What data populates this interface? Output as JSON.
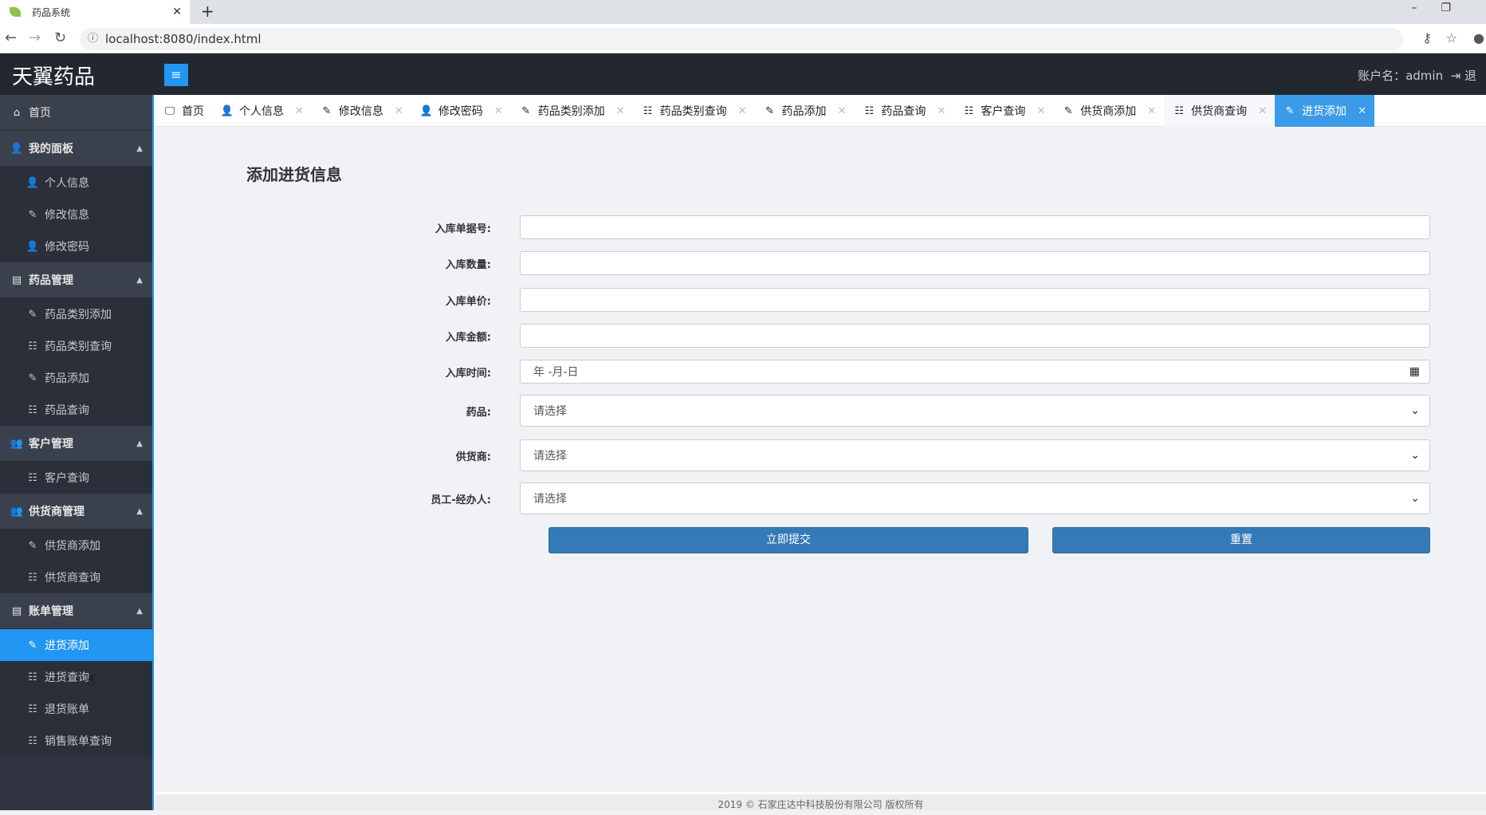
{
  "browser": {
    "tab_title": "药品系统",
    "url": "localhost:8080/index.html"
  },
  "header": {
    "logo": "天翼药品",
    "account": "账户名：admin",
    "logout": "退"
  },
  "sidebar": {
    "home": "首页",
    "groups": [
      {
        "label": "我的面板",
        "items": [
          "个人信息",
          "修改信息",
          "修改密码"
        ]
      },
      {
        "label": "药品管理",
        "items": [
          "药品类别添加",
          "药品类别查询",
          "药品添加",
          "药品查询"
        ]
      },
      {
        "label": "客户管理",
        "items": [
          "客户查询"
        ]
      },
      {
        "label": "供货商管理",
        "items": [
          "供货商添加",
          "供货商查询"
        ]
      },
      {
        "label": "账单管理",
        "items": [
          "进货添加",
          "进货查询",
          "退货账单",
          "销售账单查询"
        ]
      }
    ],
    "active": "进货添加"
  },
  "tabs": [
    "首页",
    "个人信息",
    "修改信息",
    "修改密码",
    "药品类别添加",
    "药品类别查询",
    "药品添加",
    "药品查询",
    "客户查询",
    "供货商添加",
    "供货商查询",
    "进货添加"
  ],
  "form": {
    "title": "添加进货信息",
    "fields": [
      {
        "label": "入库单据号:",
        "value": ""
      },
      {
        "label": "入库数量:",
        "value": ""
      },
      {
        "label": "入库单价:",
        "value": ""
      },
      {
        "label": "入库金额:",
        "value": ""
      },
      {
        "label": "入库时间:",
        "placeholder": "年 -月-日"
      },
      {
        "label": "药品:",
        "selected": "请选择"
      },
      {
        "label": "供货商:",
        "selected": "请选择"
      },
      {
        "label": "员工-经办人:",
        "selected": "请选择"
      }
    ],
    "submit": "立即提交",
    "reset": "重置"
  },
  "footer": "2019 © 石家庄达中科技股份有限公司 版权所有",
  "colors": {
    "accent": "#2196f3",
    "button": "#337ab7",
    "header": "#222730",
    "sidebar": "#2f3440"
  }
}
